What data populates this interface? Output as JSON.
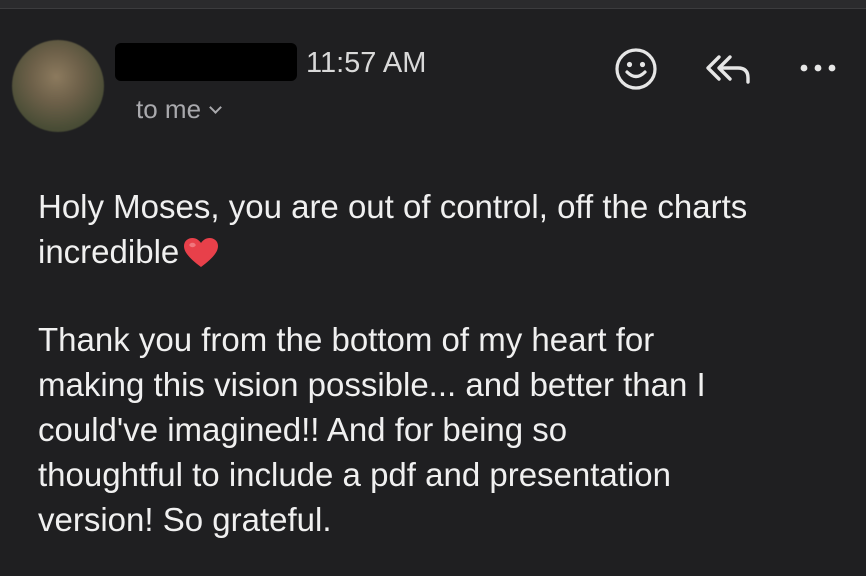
{
  "email": {
    "time": "11:57 AM",
    "recipient_label": "to me",
    "body": {
      "paragraph1": "Holy Moses, you are out of control, off the charts incredible",
      "paragraph2_lines": [
        "Thank you from the bottom of my heart for",
        "making this vision possible... and better than I",
        "could've imagined!! And for being so",
        "thoughtful to include a pdf and presentation",
        "version! So grateful."
      ]
    }
  },
  "icons": {
    "emoji": "smiley-face-icon",
    "reply_all": "reply-all-icon",
    "more": "more-options-icon",
    "heart": "red-heart-emoji"
  },
  "colors": {
    "background": "#1f1f21",
    "text_primary": "#f0f0f0",
    "text_secondary": "#a9a9ad",
    "heart": "#e8404a"
  }
}
